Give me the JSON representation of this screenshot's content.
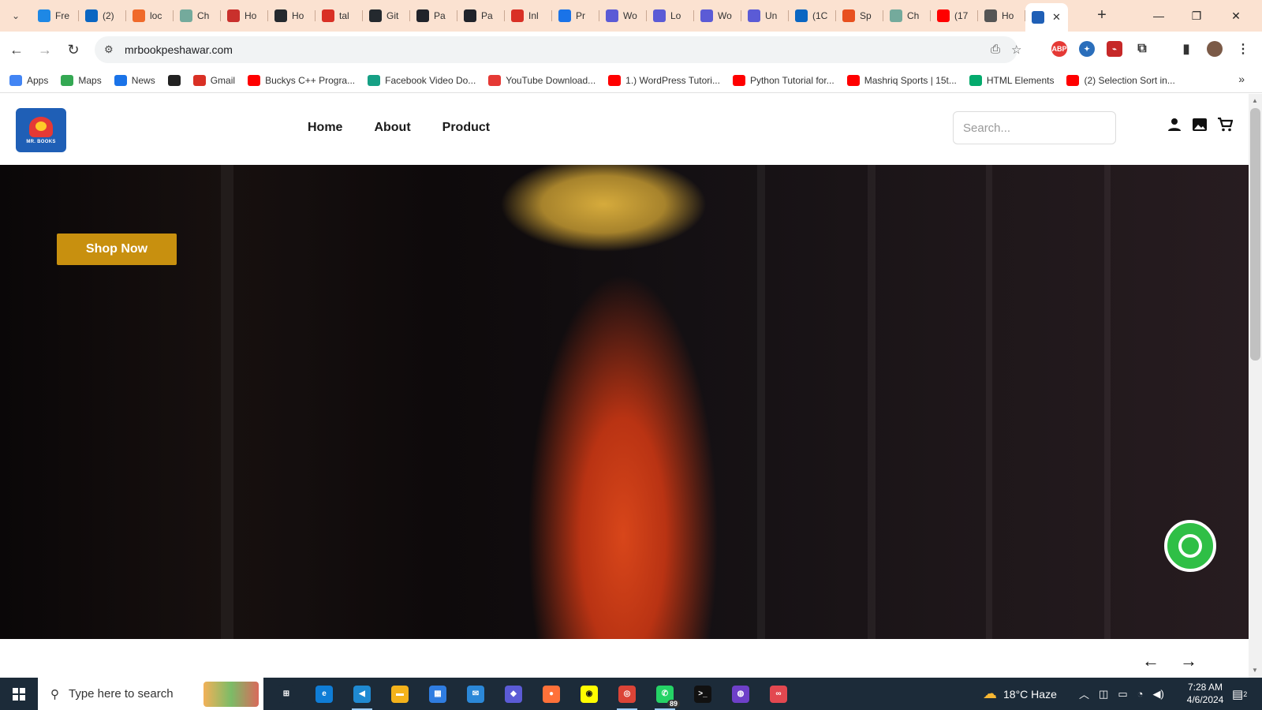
{
  "browser": {
    "tabs": [
      {
        "label": "Fre",
        "icon": "feather-icon",
        "color": "#1e88e5"
      },
      {
        "label": "(2)",
        "icon": "linkedin-icon",
        "color": "#0a66c2"
      },
      {
        "label": "loc",
        "icon": "orange-logo-icon",
        "color": "#f06a2a"
      },
      {
        "label": "Ch",
        "icon": "chatgpt-icon",
        "color": "#74aa9c"
      },
      {
        "label": "Ho",
        "icon": "hostinger-icon",
        "color": "#c9302c"
      },
      {
        "label": "Ho",
        "icon": "github-icon",
        "color": "#24292e"
      },
      {
        "label": "tal",
        "icon": "gmail-icon",
        "color": "#d93025"
      },
      {
        "label": "Git",
        "icon": "github-icon",
        "color": "#24292e"
      },
      {
        "label": "Pa",
        "icon": "react-icon",
        "color": "#20232a"
      },
      {
        "label": "Pa",
        "icon": "react-icon",
        "color": "#20232a"
      },
      {
        "label": "Inl",
        "icon": "gmail-icon",
        "color": "#d93025"
      },
      {
        "label": "Pr",
        "icon": "proton-icon",
        "color": "#1a73e8"
      },
      {
        "label": "Wo",
        "icon": "chat-icon",
        "color": "#5b5bd6"
      },
      {
        "label": "Lo",
        "icon": "chat-icon",
        "color": "#5b5bd6"
      },
      {
        "label": "Wo",
        "icon": "chat-icon",
        "color": "#5b5bd6"
      },
      {
        "label": "Un",
        "icon": "chat-icon",
        "color": "#5b5bd6"
      },
      {
        "label": "(1C",
        "icon": "linkedin-icon",
        "color": "#0a66c2"
      },
      {
        "label": "Sp",
        "icon": "spark-icon",
        "color": "#e8501f"
      },
      {
        "label": "Ch",
        "icon": "chatgpt-icon",
        "color": "#74aa9c"
      },
      {
        "label": "(17",
        "icon": "youtube-icon",
        "color": "#ff0000"
      },
      {
        "label": "Ho",
        "icon": "globe-icon",
        "color": "#555555"
      }
    ],
    "active_tab": {
      "icon": "mrbooks-favicon-icon",
      "color": "#1f5fb6"
    },
    "url": "mrbookpeshawar.com",
    "bookmarks": [
      {
        "label": "Apps",
        "icon": "apps-grid-icon",
        "color": "#4285f4"
      },
      {
        "label": "Maps",
        "icon": "maps-pin-icon",
        "color": "#34a853"
      },
      {
        "label": "News",
        "icon": "news-icon",
        "color": "#1a73e8"
      },
      {
        "label": "",
        "icon": "globe-icon",
        "color": "#222222"
      },
      {
        "label": "Gmail",
        "icon": "gmail-icon",
        "color": "#d93025"
      },
      {
        "label": "Buckys C++ Progra...",
        "icon": "youtube-icon",
        "color": "#ff0000"
      },
      {
        "label": "Facebook Video Do...",
        "icon": "download-icon",
        "color": "#16a085"
      },
      {
        "label": "YouTube Download...",
        "icon": "download-icon",
        "color": "#e53935"
      },
      {
        "label": "1.) WordPress Tutori...",
        "icon": "youtube-icon",
        "color": "#ff0000"
      },
      {
        "label": "Python Tutorial for...",
        "icon": "youtube-icon",
        "color": "#ff0000"
      },
      {
        "label": "Mashriq Sports | 15t...",
        "icon": "youtube-icon",
        "color": "#ff0000"
      },
      {
        "label": "HTML Elements",
        "icon": "w3schools-icon",
        "color": "#04aa6d"
      },
      {
        "label": "(2) Selection Sort in...",
        "icon": "youtube-icon",
        "color": "#ff0000"
      }
    ]
  },
  "site": {
    "logo_text": "MR. BOOKS",
    "nav": [
      "Home",
      "About",
      "Product"
    ],
    "search_placeholder": "Search...",
    "hero": {
      "button_label": "Shop Now",
      "accent": "#c8900f"
    },
    "arrows": {
      "prev": "←",
      "next": "→"
    }
  },
  "taskbar": {
    "search_placeholder": "Type here to search",
    "apps": [
      {
        "name": "task-view-icon",
        "glyph": "⊞",
        "color": "#1c2b39"
      },
      {
        "name": "edge-icon",
        "glyph": "e",
        "color": "#0f7dd6"
      },
      {
        "name": "vscode-icon",
        "glyph": "◀",
        "color": "#1f8ad2"
      },
      {
        "name": "file-explorer-icon",
        "glyph": "▬",
        "color": "#f3b21b"
      },
      {
        "name": "microsoft-store-icon",
        "glyph": "▦",
        "color": "#2f7de1"
      },
      {
        "name": "mail-icon",
        "glyph": "✉",
        "color": "#2b88d8"
      },
      {
        "name": "cube-app-icon",
        "glyph": "◆",
        "color": "#5b5bd6"
      },
      {
        "name": "firefox-icon",
        "glyph": "●",
        "color": "#ff7139"
      },
      {
        "name": "snapchat-icon",
        "glyph": "◉",
        "color": "#fffc00"
      },
      {
        "name": "chrome-icon",
        "glyph": "◎",
        "color": "#db4437"
      },
      {
        "name": "whatsapp-icon",
        "glyph": "✆",
        "color": "#25d366",
        "badge": "89"
      },
      {
        "name": "terminal-icon",
        "glyph": ">_",
        "color": "#111111"
      },
      {
        "name": "github-desktop-icon",
        "glyph": "◍",
        "color": "#6e40c9"
      },
      {
        "name": "creative-cloud-icon",
        "glyph": "∞",
        "color": "#e34850"
      }
    ],
    "weather": "18°C  Haze",
    "time": "7:28 AM",
    "date": "4/6/2024",
    "notification_count": "2"
  }
}
